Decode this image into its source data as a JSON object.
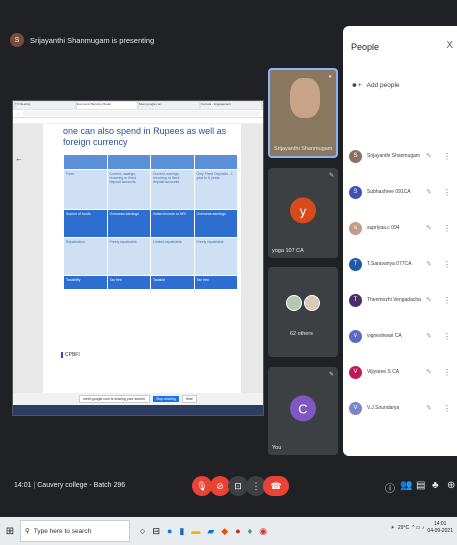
{
  "presenting": {
    "initial": "S",
    "text": "Srijayanthi Shanmugam is presenting"
  },
  "shared_screen": {
    "browser_tabs": [
      "TV Meeting",
      "Economic Banking Model",
      "Meet google.com",
      "Canvas - Engagement"
    ],
    "slide_title": "one can also spend in Rupees as well as foreign currency",
    "table": {
      "header": [
        "Form",
        "Current, savings, recurring or fixed deposit accounts",
        "Current, savings, recurring or fixed deposit accounts",
        "Only Fixed Deposits - 1 year to 5 years"
      ],
      "rows": [
        [
          "",
          "",
          "",
          ""
        ],
        [
          "Source of funds",
          "Overseas earnings",
          "Indian income or NRI",
          "Overseas earnings"
        ],
        [
          "Repatriation",
          "Freely repatriable",
          "Limited repatriable",
          "Freely repatriable"
        ],
        [
          "Taxability",
          "Tax free",
          "Taxable",
          "Tax free"
        ]
      ]
    },
    "section_label": "CPBFI",
    "share_message": "meet.google.com is sharing your screen.",
    "stop_sharing": "Stop sharing",
    "hide_label": "Hide"
  },
  "tiles": [
    {
      "name": "Srijayanthi Shanmugam",
      "initial": "",
      "color": "#8a7760"
    },
    {
      "name": "yoga 107 CA",
      "initial": "y",
      "color": "#d84a1b"
    },
    {
      "name": "62 others",
      "initial": "",
      "color": ""
    },
    {
      "name": "You",
      "initial": "C",
      "color": "#7e57c2"
    }
  ],
  "people_panel": {
    "title": "People",
    "add_people": "Add people",
    "participants": [
      {
        "name": "Srijayanthi Shanmugam",
        "initial": "S",
        "color": "#8d6e63"
      },
      {
        "name": "Subhashree 091CA",
        "initial": "S",
        "color": "#3f51b5"
      },
      {
        "name": "suprlyaa.c 094",
        "initial": "s",
        "color": "#c49a8a"
      },
      {
        "name": "T.Saravanya 077CA",
        "initial": "T",
        "color": "#1e5aa8"
      },
      {
        "name": "Thenmozhi Vengadachala...",
        "initial": "T",
        "color": "#4a2b6b"
      },
      {
        "name": "vigneshwari CA",
        "initial": "v",
        "color": "#5c6bc0"
      },
      {
        "name": "Vijiyaree.S CA",
        "initial": "V",
        "color": "#c2185b"
      },
      {
        "name": "V.J.Soundarya",
        "initial": "V",
        "color": "#7986cb"
      }
    ]
  },
  "meeting": {
    "time": "14:01",
    "name": "Cauvery college - Batch 296"
  },
  "taskbar": {
    "search_placeholder": "Type here to search",
    "weather": "29°C",
    "time": "14:01",
    "date": "04-09-2021"
  }
}
